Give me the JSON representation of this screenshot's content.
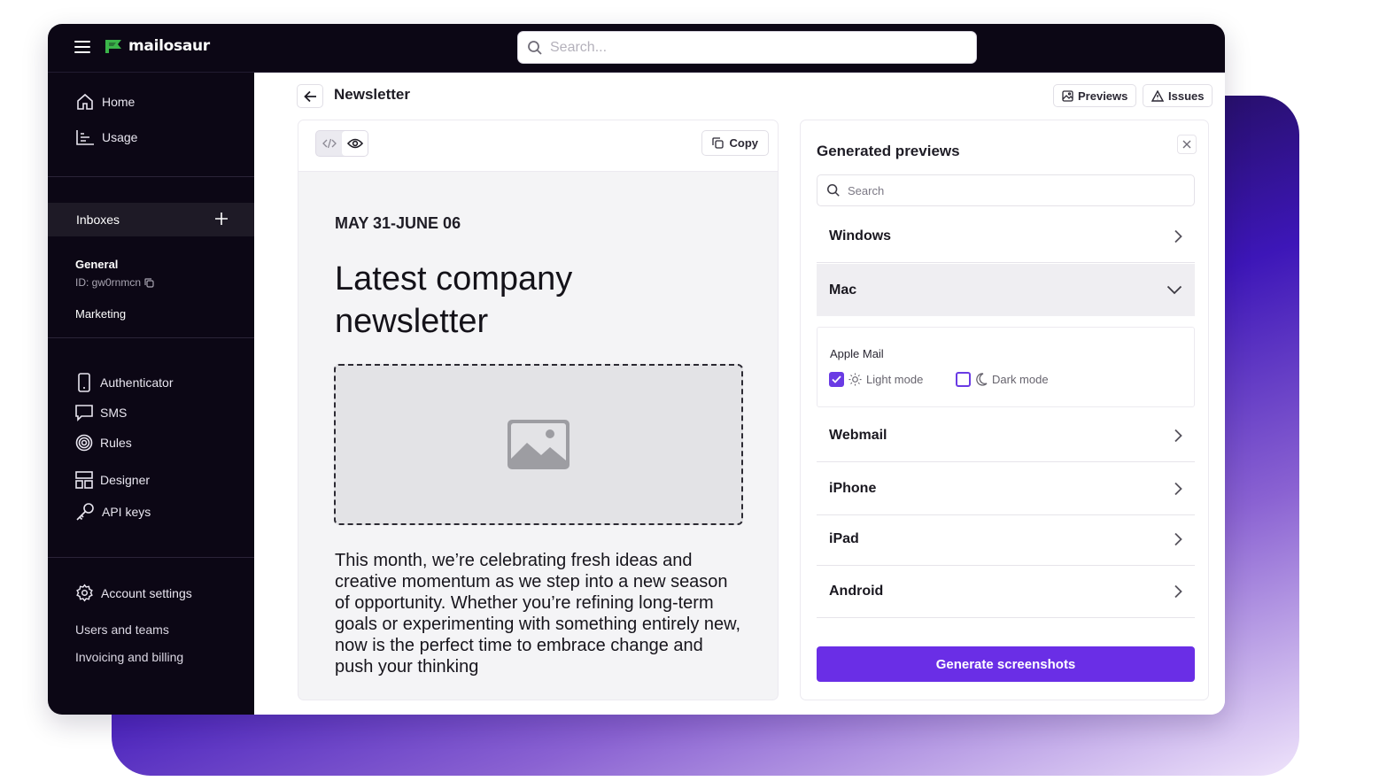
{
  "brand": {
    "name": "mailosaur",
    "accent": "#6a2ee6",
    "logo_color": "#3bb54a"
  },
  "topbar": {
    "search_placeholder": "Search..."
  },
  "sidebar": {
    "primary": [
      {
        "label": "Home",
        "icon": "home-icon"
      },
      {
        "label": "Usage",
        "icon": "chart-icon"
      }
    ],
    "inboxes_label": "Inboxes",
    "inboxes": [
      {
        "name": "General",
        "id_text": "ID: gw0rnmcn"
      },
      {
        "name": "Marketing"
      }
    ],
    "tools": [
      {
        "label": "Authenticator",
        "icon": "phone-icon"
      },
      {
        "label": "SMS",
        "icon": "message-icon"
      },
      {
        "label": "Rules",
        "icon": "target-icon"
      },
      {
        "label": "Designer",
        "icon": "layout-icon"
      },
      {
        "label": "API keys",
        "icon": "key-icon"
      }
    ],
    "account": {
      "label": "Account settings",
      "links": [
        "Users and teams",
        "Invoicing and billing"
      ]
    }
  },
  "header": {
    "title": "Newsletter",
    "previews_label": "Previews",
    "issues_label": "Issues"
  },
  "email": {
    "copy_label": "Copy",
    "date": "MAY 31-JUNE 06",
    "title": "Latest company newsletter",
    "body": "This month, we’re celebrating fresh ideas and creative momentum as we step into a new season of opportunity. Whether you’re refining long-term goals or experimenting with something entirely new, now is the perfect time to embrace change and push your thinking"
  },
  "previews": {
    "title": "Generated previews",
    "search_placeholder": "Search",
    "clients": [
      "Windows",
      "Mac",
      "Webmail",
      "iPhone",
      "iPad",
      "Android"
    ],
    "mac": {
      "app": "Apple Mail",
      "light_mode": {
        "label": "Light mode",
        "checked": true
      },
      "dark_mode": {
        "label": "Dark mode",
        "checked": false
      }
    },
    "generate_label": "Generate screenshots"
  }
}
